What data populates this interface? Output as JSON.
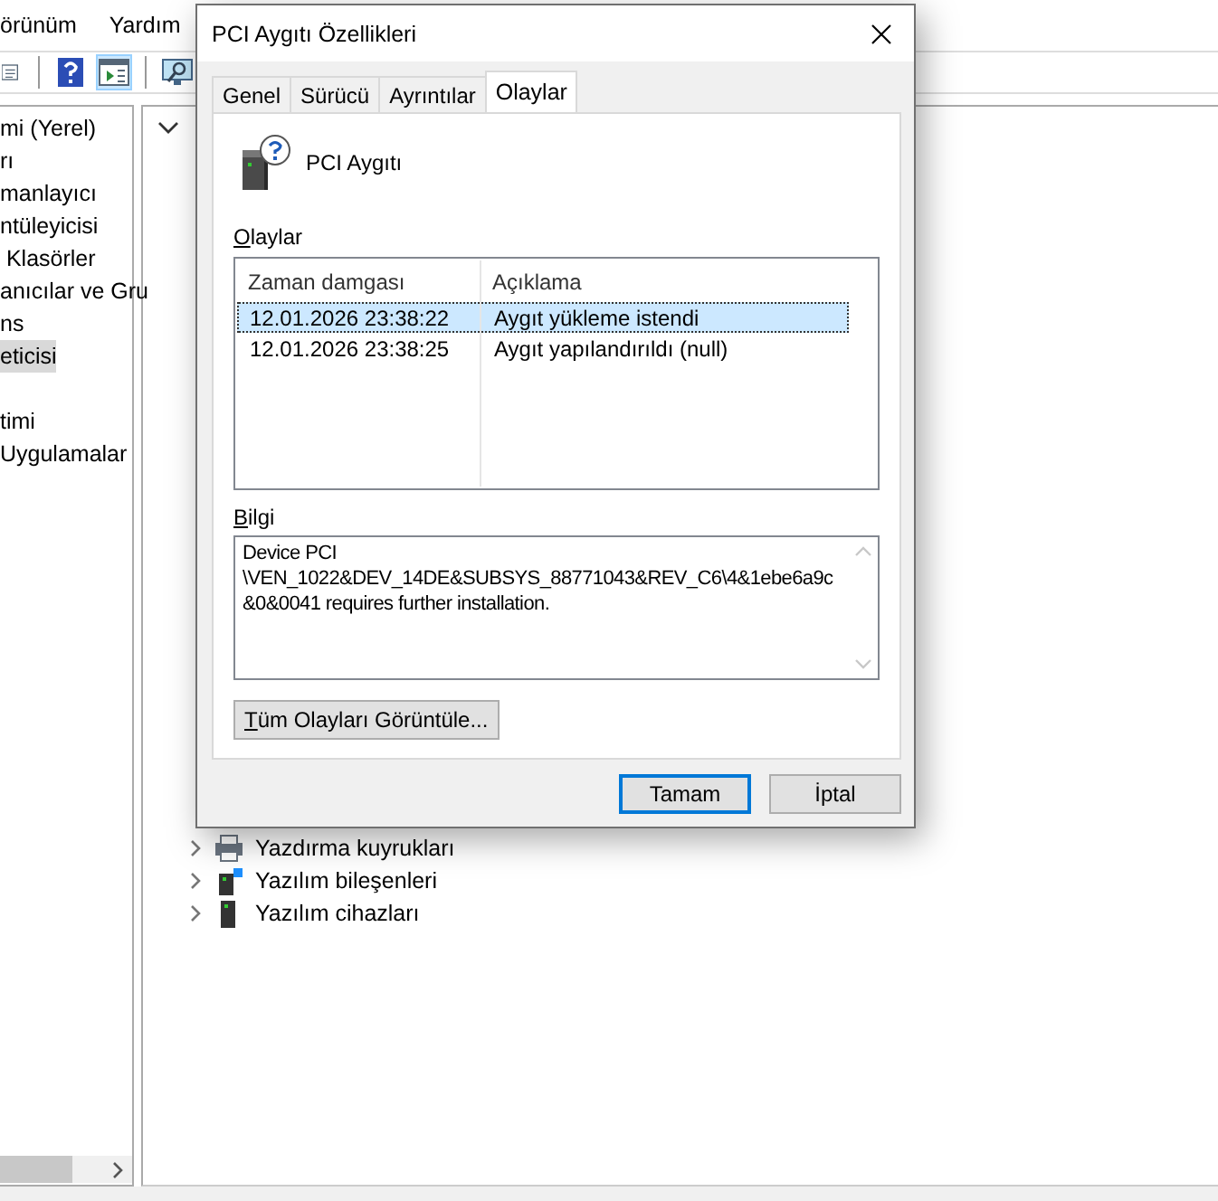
{
  "background_window": {
    "menu": [
      "örünüm",
      "Yardım"
    ],
    "toolbar": [
      {
        "kind": "list",
        "selected": false
      },
      {
        "kind": "help",
        "selected": false
      },
      {
        "kind": "panel",
        "selected": true
      },
      {
        "kind": "monitor",
        "selected": false
      }
    ],
    "tree_groups": [
      [
        {
          "label": "mi (Yerel)",
          "selected": false
        },
        {
          "label": "rı",
          "selected": false
        },
        {
          "label": "manlayıcı",
          "selected": false
        },
        {
          "label": "ntüleyicisi",
          "selected": false
        },
        {
          "label": " Klasörler",
          "selected": false
        },
        {
          "label": "anıcılar ve Gru",
          "selected": false
        },
        {
          "label": "ns",
          "selected": false
        },
        {
          "label": "eticisi",
          "selected": true
        }
      ],
      [
        {
          "label": "timi",
          "selected": false
        },
        {
          "label": "Uygulamalar",
          "selected": false
        }
      ]
    ],
    "device_tree": {
      "expanded": true,
      "children": [
        {
          "label": "Yazdırma kuyrukları",
          "kind": "printer",
          "expanded": false
        },
        {
          "label": "Yazılım bileşenleri",
          "kind": "component",
          "expanded": false
        },
        {
          "label": "Yazılım cihazları",
          "kind": "device",
          "expanded": false
        }
      ]
    }
  },
  "dialog": {
    "title": "PCI Aygıtı Özellikleri",
    "tabs": [
      {
        "label": "Genel",
        "selected": false
      },
      {
        "label": "Sürücü",
        "selected": false
      },
      {
        "label": "Ayrıntılar",
        "selected": false
      },
      {
        "label": "Olaylar",
        "selected": true
      }
    ],
    "device_name": "PCI Aygıtı",
    "events_label": "Olaylar",
    "events_table": {
      "columns": [
        "Zaman damgası",
        "Açıklama"
      ],
      "rows": [
        {
          "cells": [
            "12.01.2026 23:38:22",
            "Aygıt yükleme istendi"
          ],
          "selected": true
        },
        {
          "cells": [
            "12.01.2026 23:38:25",
            "Aygıt yapılandırıldı (null)"
          ],
          "selected": false
        }
      ]
    },
    "info_label": "Bilgi",
    "info_text": "Device PCI\n\\VEN_1022&DEV_14DE&SUBSYS_88771043&REV_C6\\4&1ebe6a9c\n&0&0041 requires further installation.",
    "view_all_button": "Tüm Olayları Görüntüle...",
    "buttons": [
      {
        "label": "Tamam",
        "default": true
      },
      {
        "label": "İptal",
        "default": false
      }
    ]
  }
}
